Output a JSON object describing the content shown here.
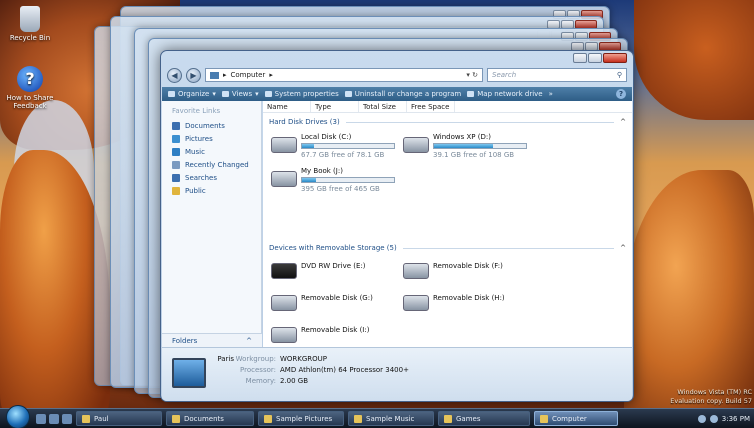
{
  "desktop": {
    "icons": [
      {
        "label": "Recycle Bin",
        "icon": "recycle-bin-icon"
      },
      {
        "label": "How to Share Feedback",
        "icon": "help-icon"
      }
    ],
    "watermark": {
      "line1": "Windows Vista (TM) RC",
      "line2": "Evaluation copy. Build 57"
    }
  },
  "window": {
    "breadcrumb_root": "Computer",
    "breadcrumb_sep": "▸",
    "search_placeholder": "Search",
    "toolbar": {
      "organize": "Organize",
      "views": "Views",
      "system_properties": "System properties",
      "uninstall": "Uninstall or change a program",
      "map_drive": "Map network drive",
      "more": "»"
    },
    "nav_pane": {
      "header": "Favorite Links",
      "links": [
        {
          "label": "Documents",
          "color": "#3b6fb0"
        },
        {
          "label": "Pictures",
          "color": "#3b8fd0"
        },
        {
          "label": "Music",
          "color": "#2e7fc4"
        },
        {
          "label": "Recently Changed",
          "color": "#7a9ac0"
        },
        {
          "label": "Searches",
          "color": "#3b6fb0"
        },
        {
          "label": "Public",
          "color": "#e0b43c"
        }
      ],
      "folders": "Folders",
      "folders_caret": "^"
    },
    "columns": [
      "Name",
      "Type",
      "Total Size",
      "Free Space"
    ],
    "groups": {
      "hdd": "Hard Disk Drives (3)",
      "removable": "Devices with Removable Storage (5)",
      "caret": "^"
    },
    "hard_drives": [
      {
        "name": "Local Disk (C:)",
        "free_text": "67.7 GB free of 78.1 GB",
        "used_fraction": 0.13
      },
      {
        "name": "Windows XP (D:)",
        "free_text": "39.1 GB free of 108 GB",
        "used_fraction": 0.64
      },
      {
        "name": "My Book (J:)",
        "free_text": "395 GB free of 465 GB",
        "used_fraction": 0.15
      }
    ],
    "removable": [
      {
        "name": "DVD RW Drive (E:)",
        "icon": "dvd-drive-icon"
      },
      {
        "name": "Removable Disk (F:)",
        "icon": "removable-disk-icon"
      },
      {
        "name": "Removable Disk (G:)",
        "icon": "removable-disk-icon"
      },
      {
        "name": "Removable Disk (H:)",
        "icon": "removable-disk-icon"
      },
      {
        "name": "Removable Disk (I:)",
        "icon": "removable-disk-icon"
      }
    ],
    "details": {
      "name": "Paris",
      "workgroup_k": "Workgroup:",
      "workgroup_v": "WORKGROUP",
      "processor_k": "Processor:",
      "processor_v": "AMD Athlon(tm) 64 Processor 3400+",
      "memory_k": "Memory:",
      "memory_v": "2.00 GB"
    }
  },
  "taskbar": {
    "buttons": [
      {
        "label": "Paul",
        "active": false
      },
      {
        "label": "Documents",
        "active": false
      },
      {
        "label": "Sample Pictures",
        "active": false
      },
      {
        "label": "Sample Music",
        "active": false
      },
      {
        "label": "Games",
        "active": false
      },
      {
        "label": "Computer",
        "active": true
      }
    ],
    "clock": "3:36 PM"
  }
}
